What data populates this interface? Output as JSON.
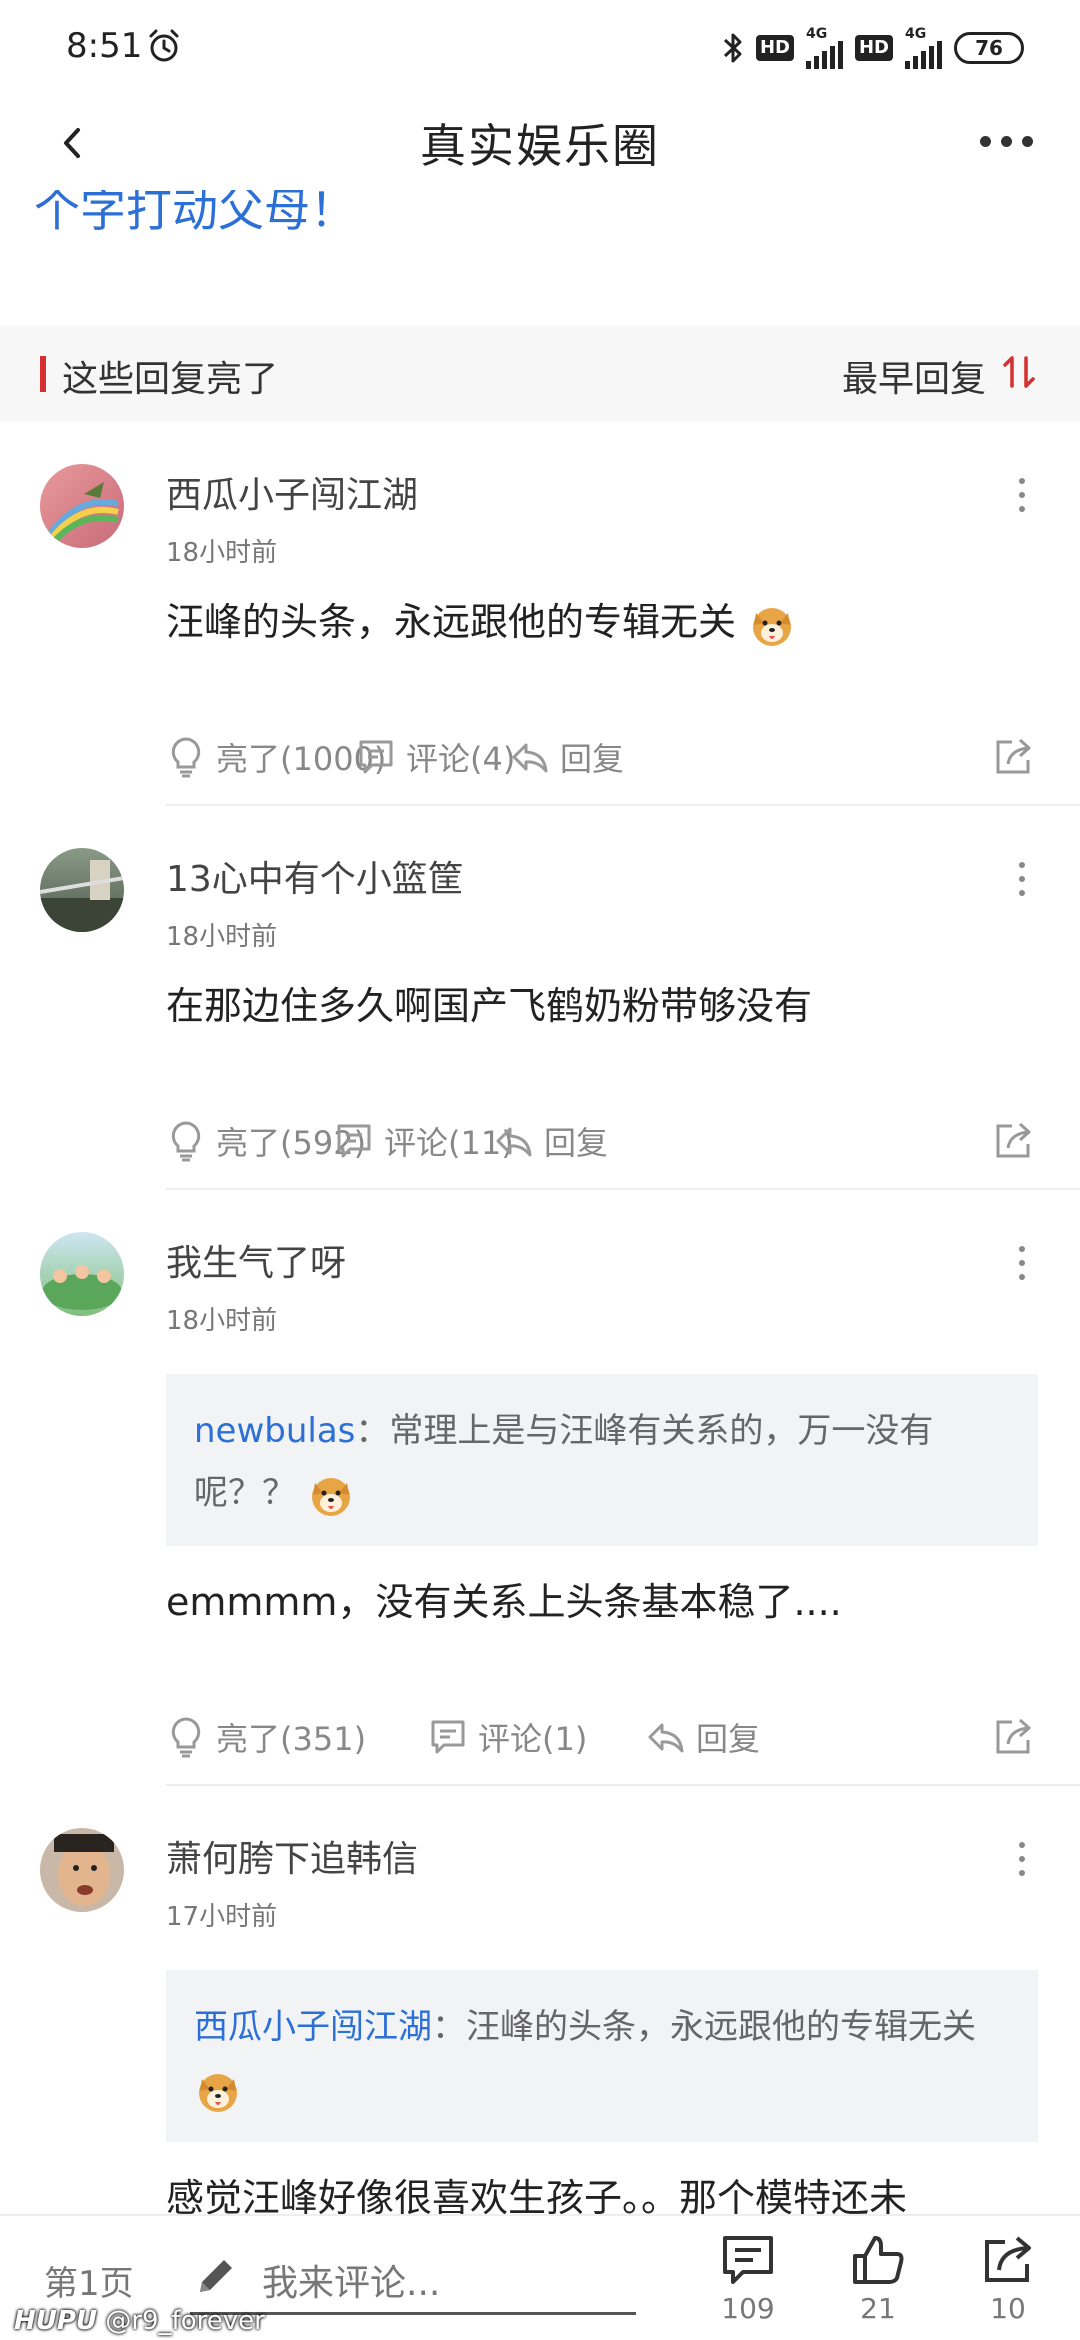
{
  "status_bar": {
    "time": "8:51",
    "hd1": "HD",
    "net1": "4G",
    "hd2": "HD",
    "net2": "4G",
    "battery": "76"
  },
  "nav": {
    "title": "真实娱乐圈"
  },
  "partial_text": "个字打动父母！",
  "section": {
    "title": "这些回复亮了",
    "sort_label": "最早回复"
  },
  "comments": [
    {
      "username": "西瓜小子闯江湖",
      "time": "18小时前",
      "content": "汪峰的头条，永远跟他的专辑无关",
      "light": "亮了(1000)",
      "comment": "评论(4)",
      "reply": "回复"
    },
    {
      "username": "13心中有个小篮筐",
      "time": "18小时前",
      "content": "在那边住多久啊国产飞鹤奶粉带够没有",
      "light": "亮了(592)",
      "comment": "评论(11)",
      "reply": "回复"
    },
    {
      "username": "我生气了呀",
      "time": "18小时前",
      "quote_name": "newbulas",
      "quote_text": "：常理上是与汪峰有关系的，万一没有呢？？",
      "content": "emmmm，没有关系上头条基本稳了....",
      "light": "亮了(351)",
      "comment": "评论(1)",
      "reply": "回复"
    },
    {
      "username": "萧何胯下追韩信",
      "time": "17小时前",
      "quote_name": "西瓜小子闯江湖",
      "quote_text": "：汪峰的头条，永远跟他的专辑无关",
      "content": "感觉汪峰好像很喜欢生孩子。。那个模特还未"
    }
  ],
  "bottom_bar": {
    "page_label": "第1页",
    "input_placeholder": "我来评论...",
    "comments_count": "109",
    "likes_count": "21",
    "shares_count": "10"
  },
  "watermark": {
    "brand": "HUPU",
    "user": "@r9_forever"
  },
  "colors": {
    "link_blue": "#2c6fd6",
    "accent_red": "#d62f2f",
    "quote_bg": "#f2f3f5"
  }
}
